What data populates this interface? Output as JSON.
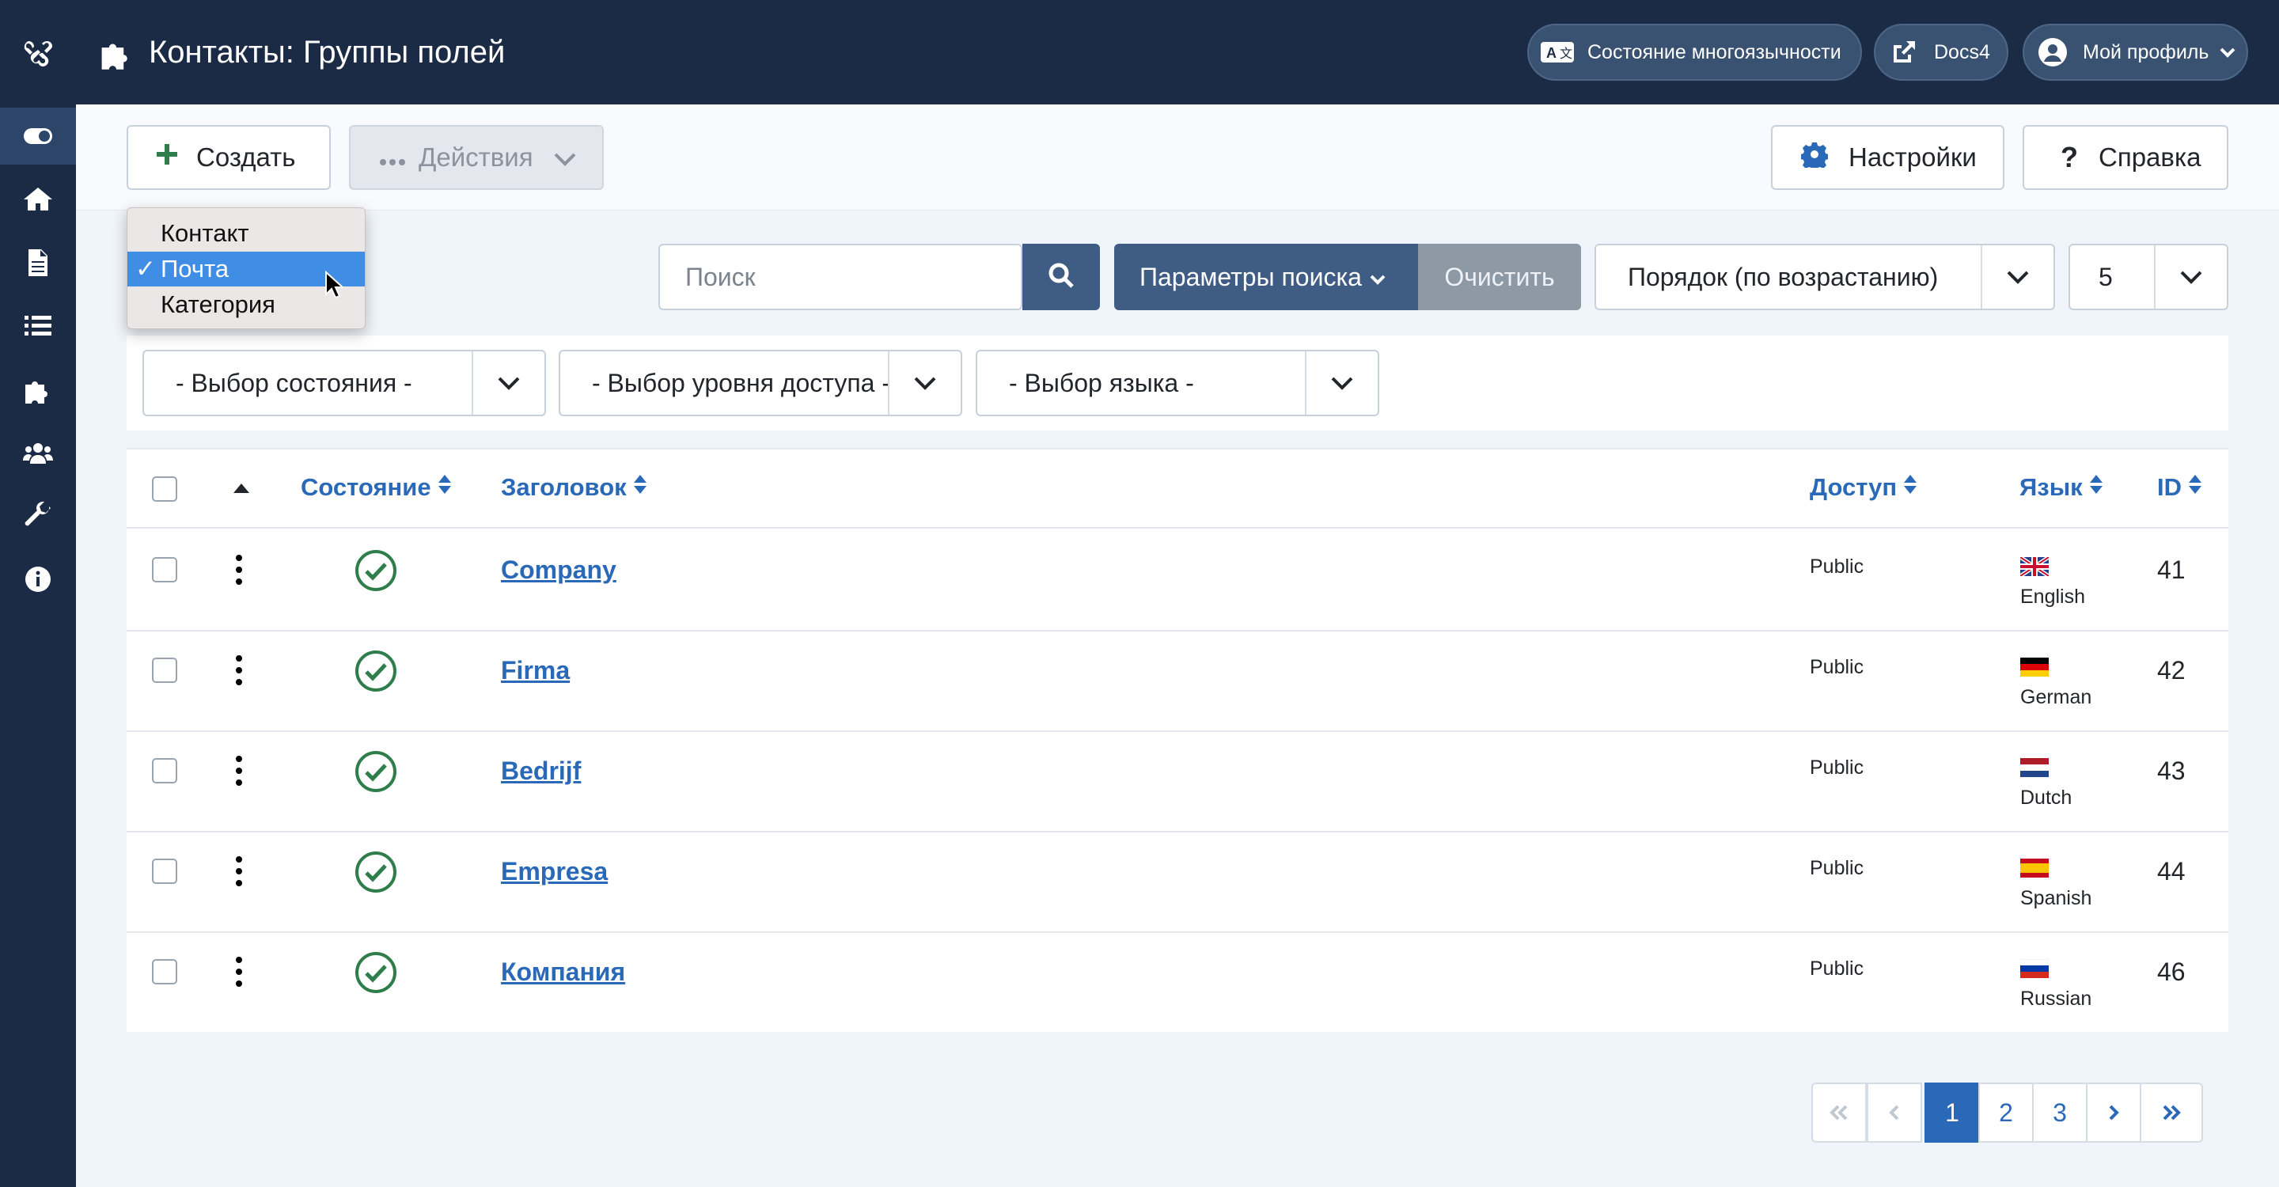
{
  "header": {
    "title": "Контакты: Группы полей",
    "multilang_label": "Состояние многоязычности",
    "docs_label": "Docs4",
    "profile_label": "Мой профиль"
  },
  "toolbar": {
    "create_label": "Создать",
    "actions_label": "Действия",
    "options_label": "Настройки",
    "help_label": "Справка"
  },
  "context_dropdown": {
    "items": [
      "Контакт",
      "Почта",
      "Категория"
    ],
    "selected": "Почта",
    "check": "✓"
  },
  "search": {
    "placeholder": "Поиск",
    "options_label": "Параметры поиска",
    "clear_label": "Очистить",
    "ordering_value": "Порядок (по возрастанию)",
    "limit_value": "5"
  },
  "filters": {
    "state": "- Выбор состояния -",
    "access": "- Выбор уровня доступа -",
    "language": "- Выбор языка -"
  },
  "table": {
    "columns": {
      "state": "Состояние",
      "title": "Заголовок",
      "access": "Доступ",
      "language": "Язык",
      "id": "ID"
    },
    "rows": [
      {
        "title": "Company",
        "access": "Public",
        "language": "English",
        "id": "41",
        "flag": "gb"
      },
      {
        "title": "Firma",
        "access": "Public",
        "language": "German",
        "id": "42",
        "flag": "de"
      },
      {
        "title": "Bedrijf",
        "access": "Public",
        "language": "Dutch",
        "id": "43",
        "flag": "nl"
      },
      {
        "title": "Empresa",
        "access": "Public",
        "language": "Spanish",
        "id": "44",
        "flag": "es"
      },
      {
        "title": "Компания",
        "access": "Public",
        "language": "Russian",
        "id": "46",
        "flag": "ru"
      }
    ]
  },
  "pagination": {
    "pages": [
      "1",
      "2",
      "3"
    ],
    "current": "1"
  },
  "colors": {
    "sidebar": "#1c2b45",
    "accent": "#2a69b8",
    "published": "#2f7d4a"
  }
}
